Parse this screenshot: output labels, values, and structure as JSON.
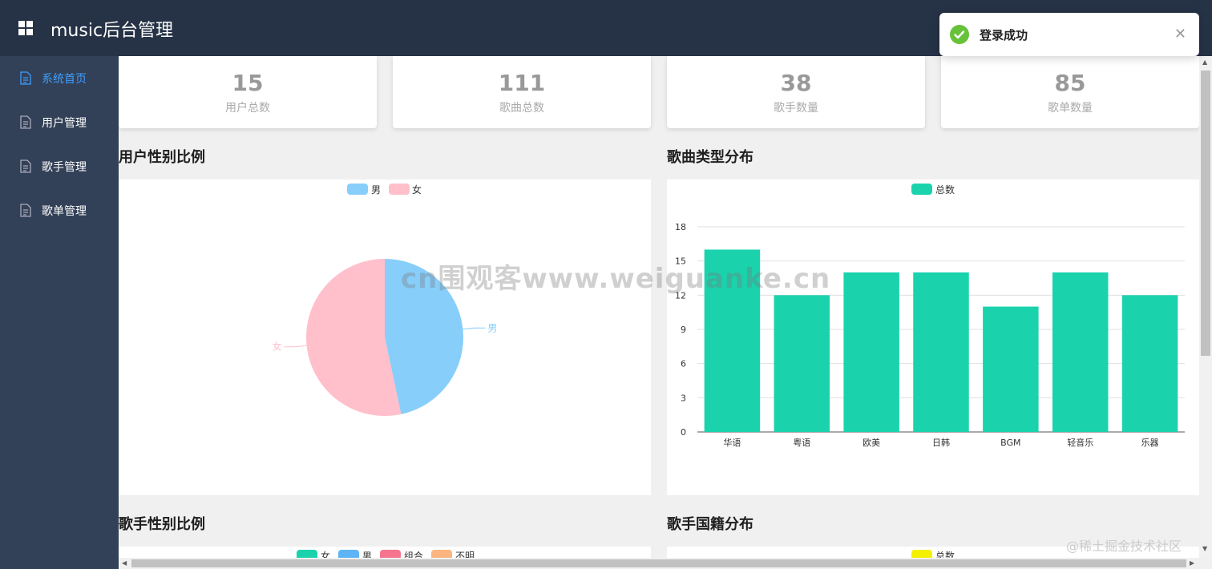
{
  "header": {
    "title": "music后台管理"
  },
  "sidebar": {
    "items": [
      {
        "label": "系统首页",
        "active": true
      },
      {
        "label": "用户管理",
        "active": false
      },
      {
        "label": "歌手管理",
        "active": false
      },
      {
        "label": "歌单管理",
        "active": false
      }
    ]
  },
  "stats": [
    {
      "value": "15",
      "label": "用户总数"
    },
    {
      "value": "111",
      "label": "歌曲总数"
    },
    {
      "value": "38",
      "label": "歌手数量"
    },
    {
      "value": "85",
      "label": "歌单数量"
    }
  ],
  "sections": {
    "user_gender": "用户性别比例",
    "song_type": "歌曲类型分布",
    "singer_gender": "歌手性别比例",
    "singer_country": "歌手国籍分布"
  },
  "chart_data": [
    {
      "type": "pie",
      "legend": [
        "男",
        "女"
      ],
      "labels": [
        "男",
        "女"
      ],
      "values": [
        7,
        8
      ],
      "colors": [
        "#87cefa",
        "#ffc0cb"
      ]
    },
    {
      "type": "bar",
      "legend": [
        "总数"
      ],
      "categories": [
        "华语",
        "粤语",
        "欧美",
        "日韩",
        "BGM",
        "轻音乐",
        "乐器"
      ],
      "values": [
        16,
        12,
        14,
        14,
        11,
        14,
        12
      ],
      "ylim": [
        0,
        18
      ],
      "yticks": [
        "0",
        "3",
        "6",
        "9",
        "12",
        "15",
        "18"
      ],
      "color": "#1ad3ad",
      "grid": true
    }
  ],
  "singer_gender_legend": [
    "女",
    "男",
    "组合",
    "不明"
  ],
  "singer_gender_colors": [
    "#1ad3ad",
    "#5eb4f5",
    "#f5748e",
    "#fcb57f"
  ],
  "singer_country_legend": [
    "总数"
  ],
  "singer_country_color": "#f5f000",
  "toast": {
    "message": "登录成功"
  },
  "watermark": "cn围观客www.weiguanke.cn",
  "footer_mark": "@稀土掘金技术社区"
}
